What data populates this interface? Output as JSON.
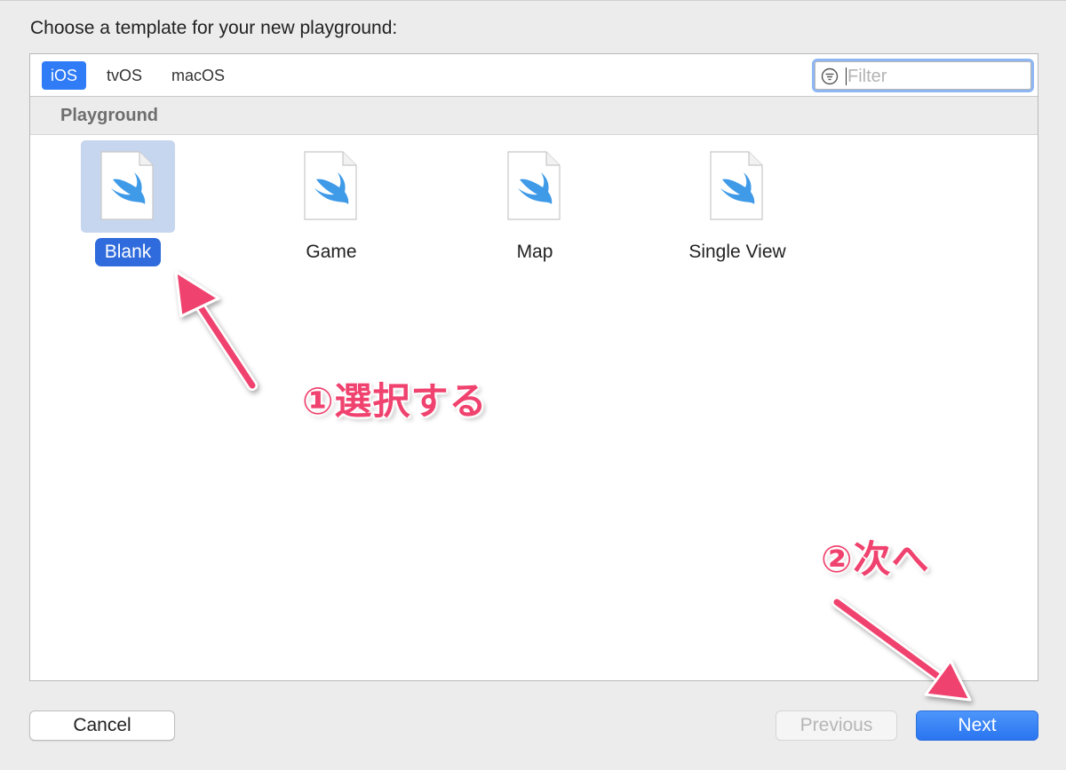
{
  "dialog": {
    "title": "Choose a template for your new playground:"
  },
  "platforms": [
    {
      "label": "iOS",
      "selected": true
    },
    {
      "label": "tvOS",
      "selected": false
    },
    {
      "label": "macOS",
      "selected": false
    }
  ],
  "filter": {
    "placeholder": "Filter",
    "value": ""
  },
  "section": {
    "title": "Playground"
  },
  "templates": [
    {
      "label": "Blank",
      "selected": true,
      "icon": "swift-file-icon"
    },
    {
      "label": "Game",
      "selected": false,
      "icon": "swift-file-icon"
    },
    {
      "label": "Map",
      "selected": false,
      "icon": "swift-file-icon"
    },
    {
      "label": "Single View",
      "selected": false,
      "icon": "swift-file-icon"
    }
  ],
  "annotations": {
    "step1": "①選択する",
    "step2": "②次へ"
  },
  "buttons": {
    "cancel": "Cancel",
    "previous": "Previous",
    "next": "Next"
  },
  "colors": {
    "accent": "#2f7cf6",
    "swift": "#3f9ae8",
    "annotation": "#f0426e"
  }
}
